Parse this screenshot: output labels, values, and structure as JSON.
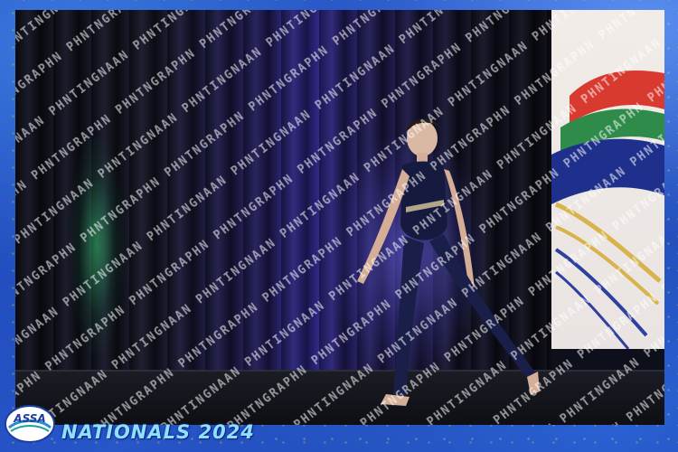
{
  "event": {
    "title": "NATIONALS 2024",
    "logo_text": "ASSA"
  },
  "watermark": {
    "text": "INGNAAN PHNTNGRAPHY"
  },
  "colors": {
    "frame_blue": "#1e47b5",
    "gold_glitter": "#e8c55a",
    "title_cyan": "#8fe0ff",
    "curtain_purple": "#3d33b8",
    "stage_green": "#3cc878",
    "leotard_navy": "#1a1f4a"
  },
  "icons": [
    "assa-logo",
    "flag-banner",
    "watermark-pattern"
  ]
}
